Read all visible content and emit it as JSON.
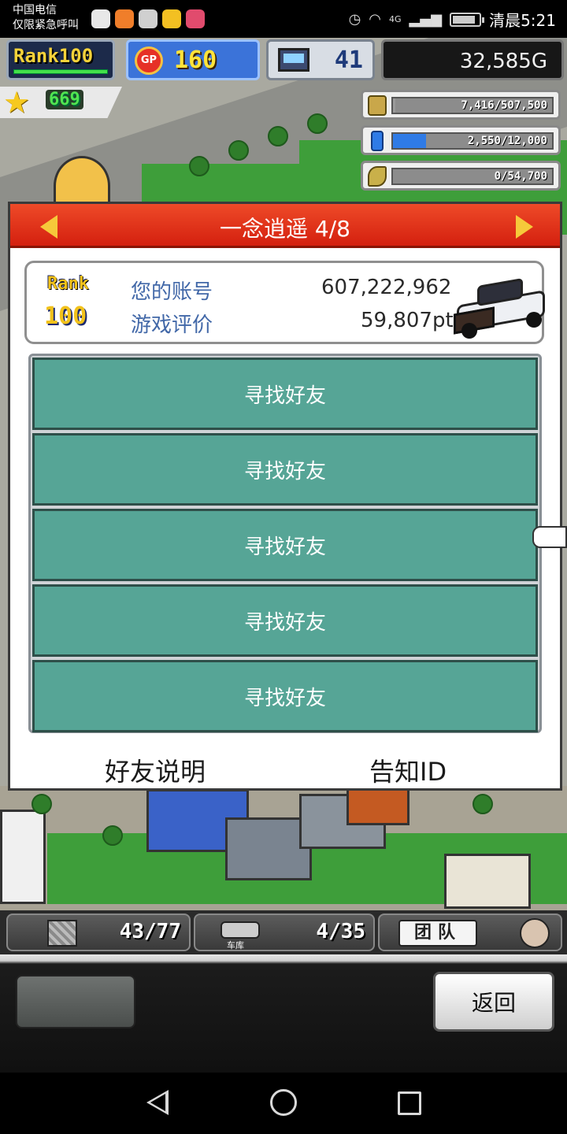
{
  "status_bar": {
    "carrier_line1": "中国电信",
    "carrier_line2": "仅限紧急呼叫",
    "network": "4G",
    "time": "清晨5:21"
  },
  "hud": {
    "rank_label": "Rank100",
    "gp_label": "GP",
    "gp_value": "160",
    "computer_value": "41",
    "gold": "32,585G",
    "star_value": "669",
    "resources": [
      {
        "icon": "coins-icon",
        "text": "7,416/507,500",
        "fill": 0.015,
        "color": "#9a9a9a"
      },
      {
        "icon": "water-bottle-icon",
        "text": "2,550/12,000",
        "fill": 0.21,
        "color": "#2f7be6"
      },
      {
        "icon": "wheat-icon",
        "text": "0/54,700",
        "fill": 0.0,
        "color": "#9a9a9a"
      }
    ]
  },
  "dialog": {
    "title": "一念逍遥 4/8",
    "rank_label": "Rank",
    "rank_value": "100",
    "account_label": "您的账号",
    "account_value": "607,222,962",
    "rating_label": "游戏评价",
    "rating_value": "59,807pt",
    "friend_slots": [
      "寻找好友",
      "寻找好友",
      "寻找好友",
      "寻找好友",
      "寻找好友"
    ],
    "friend_info_link": "好友说明",
    "notify_id_link": "告知ID"
  },
  "bottom_hud": {
    "crate_value": "43/77",
    "garage_label": "车库",
    "garage_value": "4/35",
    "team_label": "团队"
  },
  "menu": {
    "back_label": "返回"
  },
  "colors": {
    "title_red": "#e23a1e",
    "slot_green": "#56a596",
    "label_blue": "#4268a8"
  }
}
